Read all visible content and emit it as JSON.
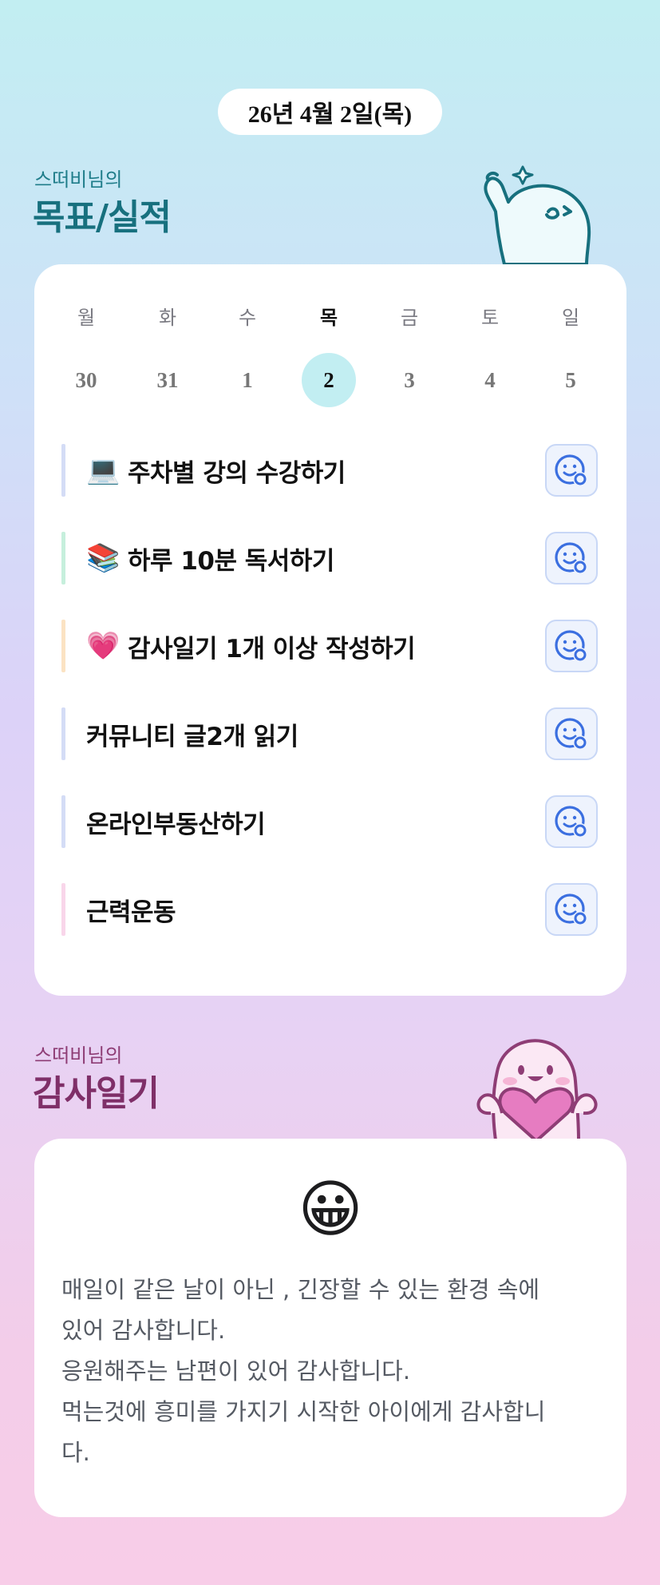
{
  "header": {
    "date": "26년 4월 2일(목)"
  },
  "goals_section": {
    "subtitle": "스떠비님의",
    "title": "목표/실적"
  },
  "calendar": {
    "days": [
      {
        "name": "월",
        "num": "30",
        "active": false
      },
      {
        "name": "화",
        "num": "31",
        "active": false
      },
      {
        "name": "수",
        "num": "1",
        "active": false
      },
      {
        "name": "목",
        "num": "2",
        "active": true
      },
      {
        "name": "금",
        "num": "3",
        "active": false
      },
      {
        "name": "토",
        "num": "4",
        "active": false
      },
      {
        "name": "일",
        "num": "5",
        "active": false
      }
    ]
  },
  "goals": [
    {
      "icon": "laptop-icon",
      "emoji": "💻",
      "label": "주차별 강의 수강하기",
      "bar_color": "#d4dcf6"
    },
    {
      "icon": "books-icon",
      "emoji": "📚",
      "label": "하루 10분 독서하기",
      "bar_color": "#c6efdc"
    },
    {
      "icon": "pink-heart-icon",
      "emoji": "💗",
      "label": "감사일기 1개 이상 작성하기",
      "bar_color": "#fbe3c3"
    },
    {
      "icon": "",
      "emoji": "",
      "label": "커뮤니티 글2개 읽기",
      "bar_color": "#d4dcf6"
    },
    {
      "icon": "",
      "emoji": "",
      "label": "온라인부동산하기",
      "bar_color": "#d4dcf6"
    },
    {
      "icon": "",
      "emoji": "",
      "label": "근력운동",
      "bar_color": "#f9d6ea"
    }
  ],
  "thanks_section": {
    "subtitle": "스떠비님의",
    "title": "감사일기"
  },
  "diary": {
    "mood_emoji": "😀",
    "lines": [
      "매일이 같은 날이 아닌 , 긴장할 수 있는 환경 속에",
      "있어 감사합니다.",
      "응원해주는 남편이 있어 감사합니다.",
      "먹는것에 흥미를 가지기 시작한 아이에게 감사합니",
      "다."
    ]
  },
  "colors": {
    "accent_teal": "#17707e",
    "accent_plum": "#7f2f68",
    "today_highlight": "#c2eef2",
    "button_bg": "#eef3fd",
    "button_icon": "#3b6fe0"
  }
}
